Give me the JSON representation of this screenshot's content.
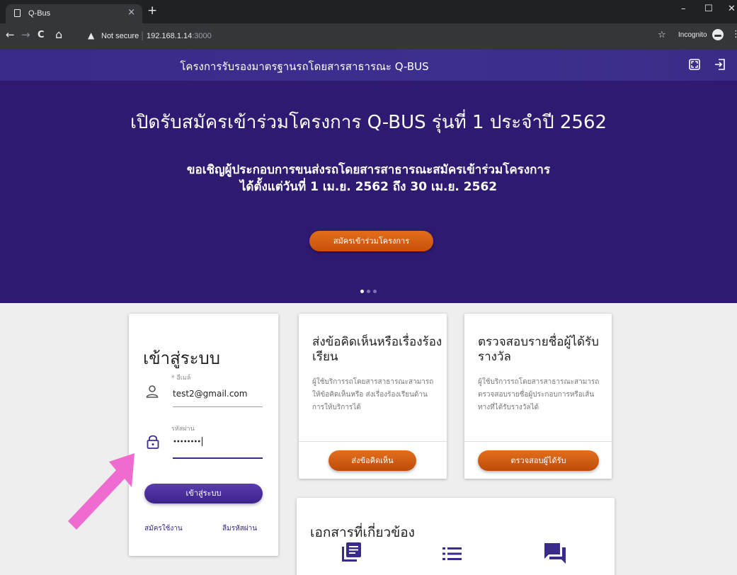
{
  "browser": {
    "tab_title": "Q-Bus",
    "tab_close": "×",
    "new_tab": "+",
    "win_min": "–",
    "win_max": "☐",
    "win_close": "✕",
    "nav_back": "←",
    "nav_forward": "→",
    "nav_reload": "C",
    "nav_home": "⌂",
    "security_warning": "▲",
    "security_text": "Not secure",
    "separator": "|",
    "url_host": "192.168.1.14",
    "url_port": ":3000",
    "bookmark_star": "☆",
    "incognito_label": "Incognito",
    "menu": "⋮"
  },
  "appbar": {
    "title": "โครงการรับรองมาตรฐานรถโดยสารสาธารณะ Q-BUS"
  },
  "hero": {
    "title": "เปิดรับสมัครเข้าร่วมโครงการ Q-BUS รุ่นที่ 1 ประจำปี 2562",
    "subtitle_line1": "ขอเชิญผู้ประกอบการขนส่งรถโดยสารสาธารณะสมัครเข้าร่วมโครงการ",
    "subtitle_line2": "ได้ตั้งแต่วันที่ 1 เม.ย. 2562 ถึง 30 เม.ย. 2562",
    "button_label": "สมัครเข้าร่วมโครงการ",
    "slide_count": 3,
    "active_slide": 1
  },
  "login": {
    "title": "เข้าสู่ระบบ",
    "email_label": "อีเมล์",
    "email_required_mark": "*",
    "email_value": "test2@gmail.com",
    "password_label": "รหัสผ่าน",
    "password_value": "••••••••",
    "submit_label": "เข้าสู่ระบบ",
    "register_link": "สมัครใช้งาน",
    "forgot_link": "ลืมรหัสผ่าน"
  },
  "feedback_card": {
    "title": "ส่งข้อคิดเห็นหรือเรื่องร้องเรียน",
    "description": "ผู้ใช้บริการรถโดยสารสาธารณะสามารถให้ข้อคิดเห็นหรือ ส่งเรื่องร้องเรียนด้านการให้บริการได้",
    "button_label": "ส่งข้อคิดเห็น"
  },
  "award_card": {
    "title": "ตรวจสอบรายชื่อผู้ได้รับรางวัล",
    "description": "ผู้ใช้บริการรถโดยสารสาธารณะสามารถตรวจสอบรายชื่อผู้ประกอบการหรือเส้นทางที่ได้รับรางวัลได้",
    "button_label": "ตรวจสอบผู้ได้รับ"
  },
  "docs_card": {
    "title": "เอกสารที่เกี่ยวข้อง",
    "icons": [
      "library-books-icon",
      "list-icon",
      "forum-icon"
    ]
  },
  "colors": {
    "primary": "#3a2a8a",
    "hero_bg": "#2f1a72",
    "accent": "#d8601a",
    "annotation_arrow": "#f06bd0"
  }
}
